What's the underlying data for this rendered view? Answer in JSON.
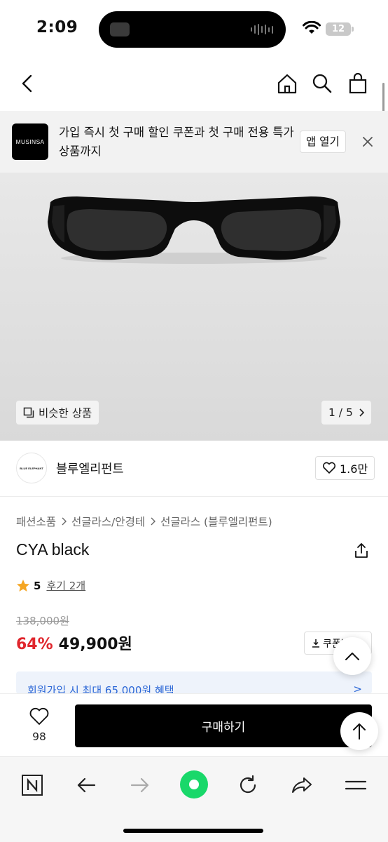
{
  "status": {
    "time": "2:09",
    "battery": "12"
  },
  "promo": {
    "logo": "MUSINSA",
    "text": "가입 즉시 첫 구매 할인 쿠폰과 첫 구매 전용 특가 상품까지",
    "open_label": "앱 열기"
  },
  "hero": {
    "similar_label": "비슷한 상품",
    "pager": "1 / 5"
  },
  "brand": {
    "logo_text": "BLUE ELEPHANT",
    "name": "블루엘리펀트",
    "likes": "1.6만"
  },
  "breadcrumb": [
    "패션소품",
    "선글라스/안경테",
    "선글라스 (블루엘리펀트)"
  ],
  "product": {
    "title": "CYA black",
    "rating": "5",
    "reviews": "후기 2개",
    "original_price": "138,000원",
    "discount": "64%",
    "sale_price": "49,900원",
    "coupon_label": "쿠폰받기"
  },
  "benefit": {
    "text": "회원가입 시 최대 65,000원 혜택",
    "arrow": ">"
  },
  "purchase": {
    "wish_count": "98",
    "buy_label": "구매하기"
  },
  "icons": {
    "back": "chevron-left-icon",
    "home": "home-icon",
    "search": "search-icon",
    "bag": "shopping-bag-icon",
    "close": "close-icon",
    "star_color": "#f5a623"
  }
}
